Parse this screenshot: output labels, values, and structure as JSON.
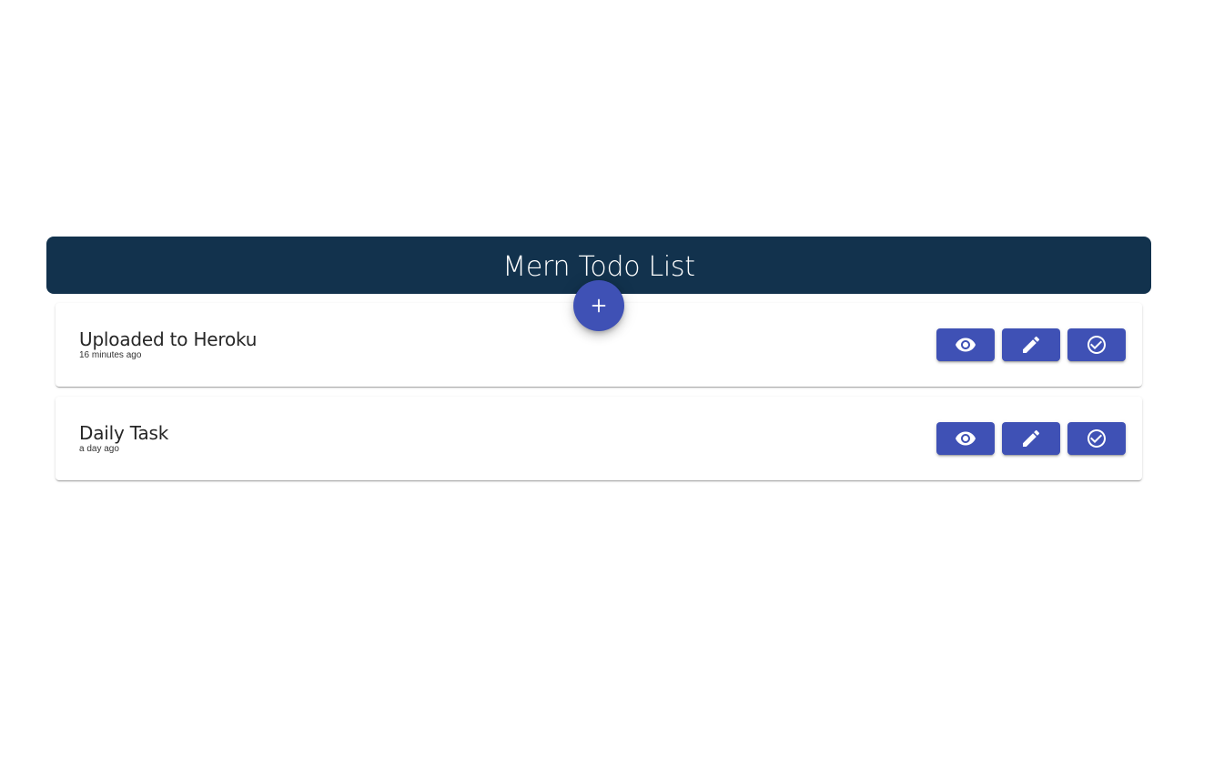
{
  "header": {
    "title": "Mern Todo List"
  },
  "fab": {
    "icon": "plus-icon",
    "label": "+"
  },
  "todos": [
    {
      "title": "Uploaded to Heroku",
      "time": "16 minutes ago",
      "actions": [
        "eye-icon",
        "pencil-icon",
        "check-circle-icon"
      ]
    },
    {
      "title": "Daily Task",
      "time": "a day ago",
      "actions": [
        "eye-icon",
        "pencil-icon",
        "check-circle-icon"
      ]
    }
  ],
  "colors": {
    "header_bg": "#12324d",
    "primary": "#3f51b5",
    "background": "#ffffff"
  }
}
